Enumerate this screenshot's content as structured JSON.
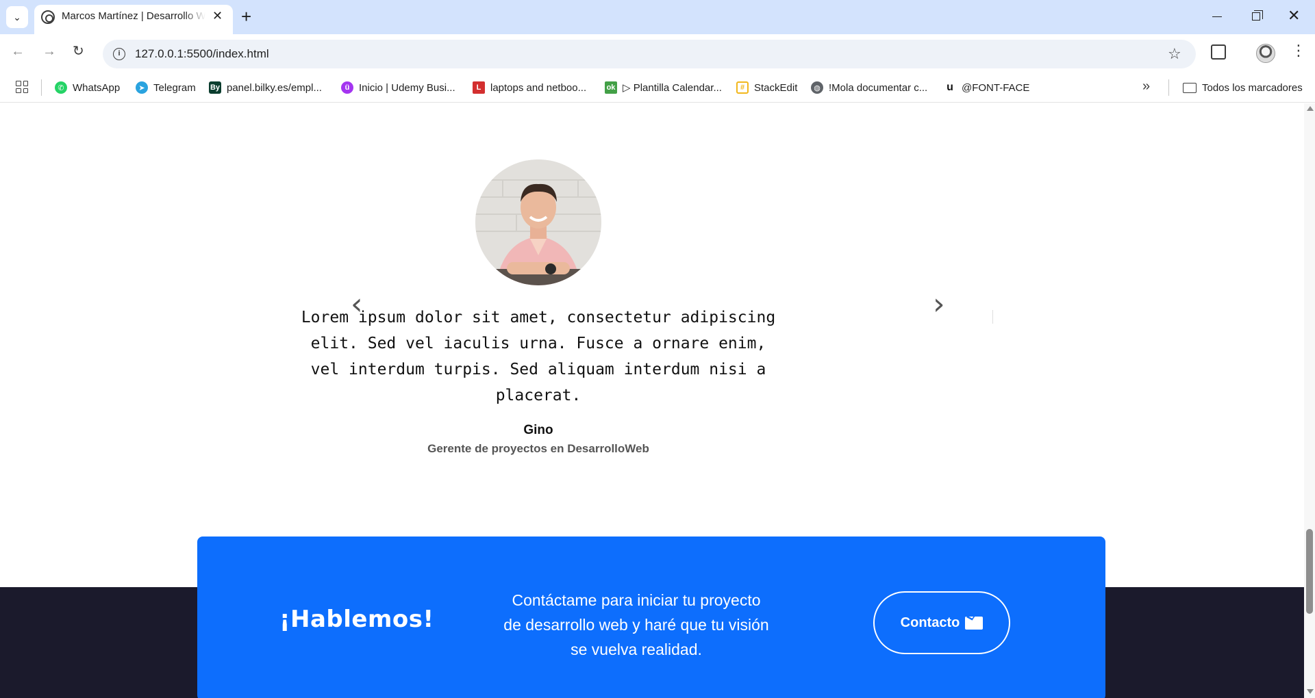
{
  "browser": {
    "tab_title": "Marcos Martínez | Desarrollo Web",
    "url": "127.0.0.1:5500/index.html",
    "bookmarks": [
      {
        "label": "WhatsApp",
        "icon": "whatsapp-icon",
        "color": "#25d366"
      },
      {
        "label": "Telegram",
        "icon": "telegram-icon",
        "color": "#2aa3df"
      },
      {
        "label": "panel.bilky.es/empl...",
        "icon": "bilky-icon",
        "color": "#0b3d2e"
      },
      {
        "label": "Inicio | Udemy Busi...",
        "icon": "udemy-icon",
        "color": "#a435f0"
      },
      {
        "label": "laptops and netboo...",
        "icon": "l-icon",
        "color": "#d32f2f"
      },
      {
        "label": "▷ Plantilla Calendar...",
        "icon": "ok-icon",
        "color": "#43a047"
      },
      {
        "label": "StackEdit",
        "icon": "stackedit-icon",
        "color": "#f2b71c"
      },
      {
        "label": "!Mola documentar c...",
        "icon": "globe-icon",
        "color": "#5f6368"
      },
      {
        "label": "@FONT-FACE",
        "icon": "u-icon",
        "color": "#111111"
      }
    ],
    "all_bookmarks": "Todos los marcadores"
  },
  "testimonial": {
    "quote": "Lorem ipsum dolor sit amet, consectetur adipiscing elit. Sed vel iaculis urna. Fusce a ornare enim, vel interdum turpis. Sed aliquam interdum nisi a placerat.",
    "name": "Gino",
    "role": "Gerente de proyectos en DesarrolloWeb",
    "prev_arrow": "‹",
    "next_arrow": "›"
  },
  "cta": {
    "title": "¡Hablemos!",
    "text": "Contáctame para iniciar tu proyecto de desarrollo web y haré que tu visión se vuelva realidad.",
    "button_label": "Contacto"
  },
  "colors": {
    "tabstrip": "#d3e3fd",
    "cta_blue": "#0d6efd",
    "footer_dark": "#1b1a2c"
  }
}
